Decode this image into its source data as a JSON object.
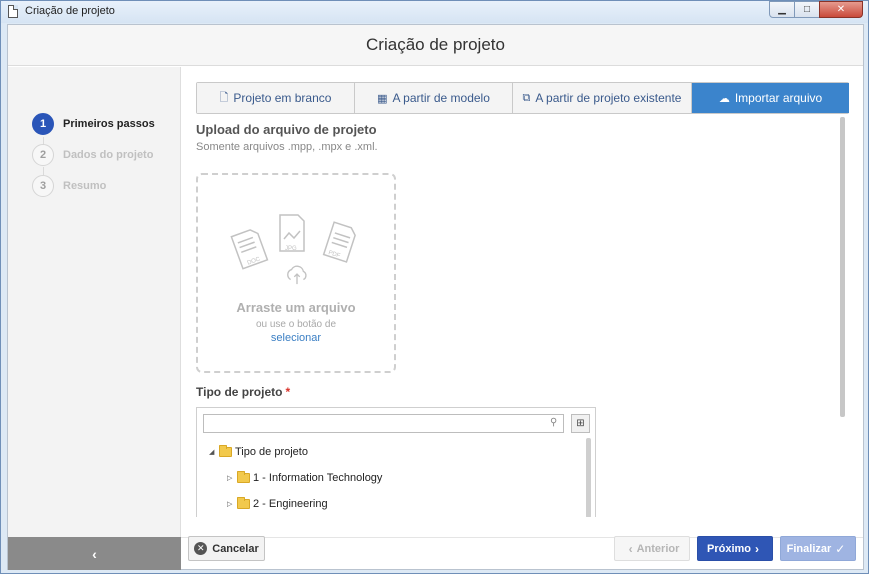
{
  "window": {
    "title": "Criação de projeto",
    "buttons": {
      "minimize": "▁",
      "maximize": "□",
      "close": "✕"
    }
  },
  "dialog": {
    "title": "Criação de projeto"
  },
  "steps": [
    {
      "number": "1",
      "label": "Primeiros passos",
      "active": true
    },
    {
      "number": "2",
      "label": "Dados do projeto",
      "active": false
    },
    {
      "number": "3",
      "label": "Resumo",
      "active": false
    }
  ],
  "tabs": [
    {
      "label": "Projeto em branco",
      "icon": "file-icon",
      "glyph": "🗋"
    },
    {
      "label": "A partir de modelo",
      "icon": "grid-icon",
      "glyph": "▦"
    },
    {
      "label": "A partir de projeto existente",
      "icon": "copy-icon",
      "glyph": "⧉"
    },
    {
      "label": "Importar arquivo",
      "icon": "cloud-upload-icon",
      "glyph": "☁",
      "active": true
    }
  ],
  "upload": {
    "title": "Upload do arquivo de projeto",
    "subtitle": "Somente arquivos .mpp, .mpx e .xml.",
    "drop_title": "Arraste um arquivo",
    "drop_hint": "ou use o botão de",
    "drop_link": "selecionar",
    "file_icons": [
      "DOC",
      "JPG",
      "PDF"
    ]
  },
  "project_type": {
    "label": "Tipo de projeto",
    "required_mark": "*",
    "search_value": "",
    "tree": [
      {
        "label": "Tipo de projeto",
        "expanded": true,
        "level": 0
      },
      {
        "label": "1 - Information Technology",
        "expanded": false,
        "level": 1
      },
      {
        "label": "2 - Engineering",
        "expanded": false,
        "level": 1
      }
    ]
  },
  "footer": {
    "cancel": "Cancelar",
    "previous": "Anterior",
    "next": "Próximo",
    "finish": "Finalizar"
  },
  "colors": {
    "primary": "#2f56b5",
    "tab_active": "#3b84cc",
    "required": "#d9332b"
  }
}
